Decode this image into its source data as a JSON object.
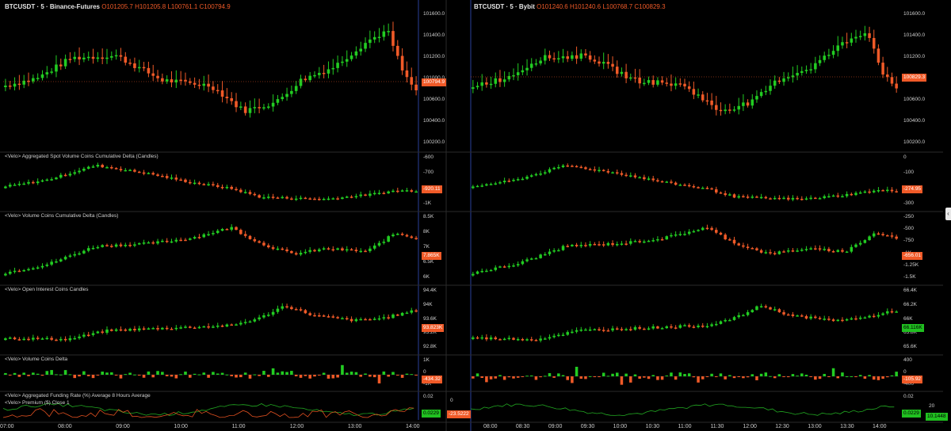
{
  "left": {
    "header": {
      "symbol": "BTCUSDT · 5 · Binance-Futures",
      "o": "O101205.7",
      "h": "H101205.8",
      "l": "L100761.1",
      "c": "C100794.9"
    },
    "panes": [
      {
        "name": "price",
        "label": "",
        "ticks": [
          "101600.0",
          "101400.0",
          "101200.0",
          "101000.0",
          "100600.0",
          "100400.0",
          "100200.0"
        ],
        "tag": "100794.9",
        "tag_color": "red"
      },
      {
        "name": "spot-cvd",
        "label": "<Velo> Aggregated Spot Volume Coins Cumulative Delta (Candles)",
        "ticks": [
          "-600",
          "-700",
          "-800",
          "-1K"
        ],
        "tag": "-920.11",
        "tag_color": "red"
      },
      {
        "name": "cvd",
        "label": "<Velo> Volume Coins Cumulative Delta (Candles)",
        "ticks": [
          "8.5K",
          "8K",
          "7K",
          "6.5K",
          "6K"
        ],
        "tag": "7.865K",
        "tag_color": "red"
      },
      {
        "name": "oi",
        "label": "<Velo> Open Interest Coins Candles",
        "ticks": [
          "94.4K",
          "94K",
          "93.6K",
          "93.2K",
          "92.8K"
        ],
        "tag": "93.823K",
        "tag_color": "red"
      },
      {
        "name": "delta",
        "label": "<Velo> Volume Coins Delta",
        "ticks": [
          "1K",
          "0",
          "-1K"
        ],
        "tag": "-434.32",
        "tag_color": "red"
      },
      {
        "name": "funding",
        "label": "<Velo> Aggregated Funding Rate (%) Average 8 Hours Average",
        "label2": "<Velo> Premium ($) Close 1",
        "ticks": [
          "0.02",
          "0.01"
        ],
        "tag": "0.0229",
        "tag_color": "green"
      }
    ],
    "times": [
      "07:00",
      "08:00",
      "09:00",
      "10:00",
      "11:00",
      "12:00",
      "13:00",
      "14:00"
    ],
    "premium_axis": {
      "ticks": [
        "0"
      ],
      "tag": "-23.5222"
    }
  },
  "right": {
    "header": {
      "symbol": "BTCUSDT · 5 · Bybit",
      "o": "O101240.6",
      "h": "H101240.6",
      "l": "L100768.7",
      "c": "C100829.3"
    },
    "panes": [
      {
        "name": "price",
        "label": "",
        "ticks": [
          "101600.0",
          "101400.0",
          "101200.0",
          "101000.0",
          "100600.0",
          "100400.0",
          "100200.0"
        ],
        "tag": "100829.3",
        "tag_color": "red"
      },
      {
        "name": "spot-cvd",
        "label": "",
        "ticks": [
          "0",
          "-100",
          "-200",
          "-300"
        ],
        "tag": "-274.95",
        "tag_color": "red"
      },
      {
        "name": "cvd",
        "label": "",
        "ticks": [
          "-250",
          "-500",
          "-750",
          "-1K",
          "-1.25K",
          "-1.5K"
        ],
        "tag": "-656.01",
        "tag_color": "red"
      },
      {
        "name": "oi",
        "label": "",
        "ticks": [
          "66.4K",
          "66.2K",
          "66K",
          "65.8K",
          "65.6K"
        ],
        "tag": "66.116K",
        "tag_color": "green"
      },
      {
        "name": "delta",
        "label": "",
        "ticks": [
          "400",
          "0",
          "-400"
        ],
        "tag": "-105.92",
        "tag_color": "red"
      },
      {
        "name": "funding",
        "label": "",
        "ticks": [
          "0.02",
          "0.01"
        ],
        "tag": "0.0229",
        "tag_color": "green"
      }
    ],
    "times": [
      "08:00",
      "08:30",
      "09:00",
      "09:30",
      "10:00",
      "10:30",
      "11:00",
      "11:30",
      "12:00",
      "12:30",
      "13:00",
      "13:30",
      "14:00"
    ],
    "premium_axis": {
      "ticks": [
        "20"
      ],
      "tag": "10.1448"
    }
  },
  "colors": {
    "up": "#22cc22",
    "down": "#f05a28",
    "grid": "#1a1a1a",
    "sep": "#2a2a2a",
    "funding": "#22aa22",
    "premium": "#e05020"
  }
}
